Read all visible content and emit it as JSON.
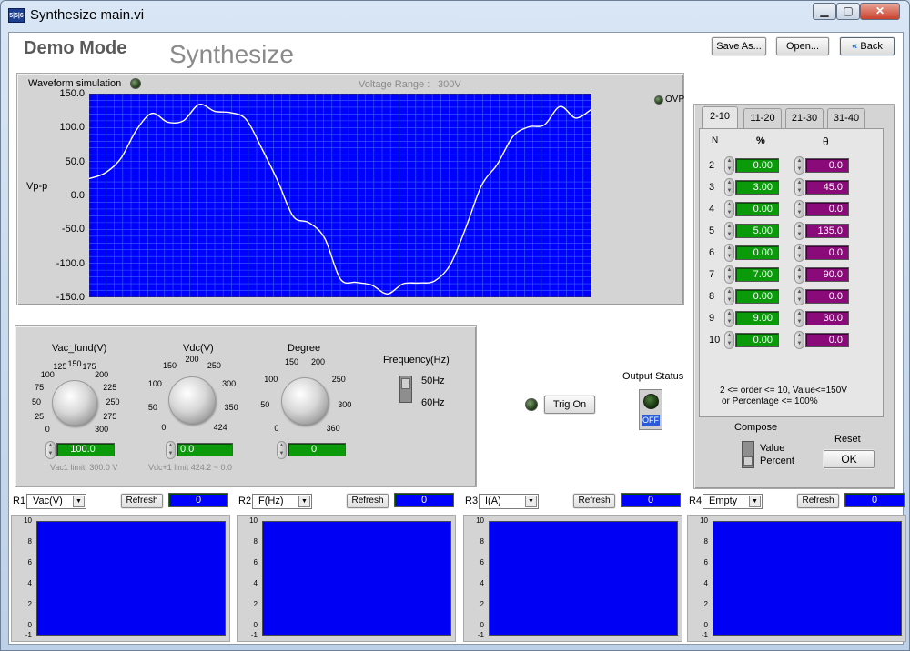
{
  "window": {
    "icon_text": "5|5|6",
    "title": "Synthesize main.vi"
  },
  "header": {
    "mode": "Demo Mode",
    "title": "Synthesize",
    "save_as": "Save As...",
    "open": "Open...",
    "back": "Back"
  },
  "waveform": {
    "label": "Waveform simulation",
    "voltage_range_label": "Voltage Range :",
    "voltage_range_value": "300V",
    "y_axis_label": "Vp-p",
    "ovp_label": "OVP",
    "y_ticks": [
      "150.0",
      "100.0",
      "50.0",
      "0.0",
      "-50.0",
      "-100.0",
      "-150.0"
    ]
  },
  "chart_data": {
    "type": "line",
    "title": "Waveform simulation",
    "xlabel": "",
    "ylabel": "Vp-p",
    "ylim": [
      -150,
      150
    ],
    "grid": true,
    "line_color": "#ffffff",
    "background": "#0000ff",
    "series": [
      {
        "values": [
          24.8,
          33,
          54,
          96,
          121,
          108,
          110,
          134,
          124,
          122,
          112,
          69,
          22,
          -31,
          -40,
          -63,
          -123,
          -128,
          -132,
          -145,
          -130,
          -129,
          -126,
          -102,
          -47,
          15,
          46,
          87,
          101,
          104,
          131,
          114,
          127
        ]
      }
    ]
  },
  "controls": {
    "vac_fund": {
      "label": "Vac_fund(V)",
      "ticks": [
        "0",
        "25",
        "50",
        "75",
        "100",
        "125",
        "150",
        "175",
        "200",
        "225",
        "250",
        "275",
        "300"
      ],
      "value": "100.0",
      "limit_text": "Vac1 limit:  300.0  V"
    },
    "vdc": {
      "label": "Vdc(V)",
      "ticks": [
        "0",
        "50",
        "100",
        "150",
        "200",
        "250",
        "300",
        "350",
        "424"
      ],
      "value": "0.0",
      "limit_text": "Vdc+1 limit   424.2  ~  0.0"
    },
    "degree": {
      "label": "Degree",
      "ticks": [
        "0",
        "50",
        "100",
        "150",
        "200",
        "250",
        "300",
        "360"
      ],
      "value": "0"
    },
    "frequency": {
      "label": "Frequency(Hz)",
      "opt1": "50Hz",
      "opt2": "60Hz"
    }
  },
  "trig": {
    "label": "Trig On"
  },
  "output_status": {
    "label": "Output Status",
    "state": "OFF"
  },
  "harmonics": {
    "tabs": [
      "2-10",
      "11-20",
      "21-30",
      "31-40"
    ],
    "col_n": "N",
    "col_pct": "%",
    "col_theta": "θ",
    "rows": [
      {
        "n": "2",
        "pct": "0.00",
        "theta": "0.0"
      },
      {
        "n": "3",
        "pct": "3.00",
        "theta": "45.0"
      },
      {
        "n": "4",
        "pct": "0.00",
        "theta": "0.0"
      },
      {
        "n": "5",
        "pct": "5.00",
        "theta": "135.0"
      },
      {
        "n": "6",
        "pct": "0.00",
        "theta": "0.0"
      },
      {
        "n": "7",
        "pct": "7.00",
        "theta": "90.0"
      },
      {
        "n": "8",
        "pct": "0.00",
        "theta": "0.0"
      },
      {
        "n": "9",
        "pct": "9.00",
        "theta": "30.0"
      },
      {
        "n": "10",
        "pct": "0.00",
        "theta": "0.0"
      }
    ],
    "note1": "2 <=  order  <= 10,  Value<=150V",
    "note2": "or Percentage <= 100%"
  },
  "compose": {
    "label": "Compose",
    "opt1": "Value",
    "opt2": "Percent",
    "reset_label": "Reset",
    "ok": "OK"
  },
  "readouts": [
    {
      "id": "R1",
      "select": "Vac(V)",
      "refresh": "Refresh",
      "value": "0"
    },
    {
      "id": "R2",
      "select": "F(Hz)",
      "refresh": "Refresh",
      "value": "0"
    },
    {
      "id": "R3",
      "select": "I(A)",
      "refresh": "Refresh",
      "value": "0"
    },
    {
      "id": "R4",
      "select": "Empty",
      "refresh": "Refresh",
      "value": "0"
    }
  ],
  "mini_y_ticks": [
    "10",
    "8",
    "6",
    "4",
    "2",
    "0",
    "-1"
  ]
}
